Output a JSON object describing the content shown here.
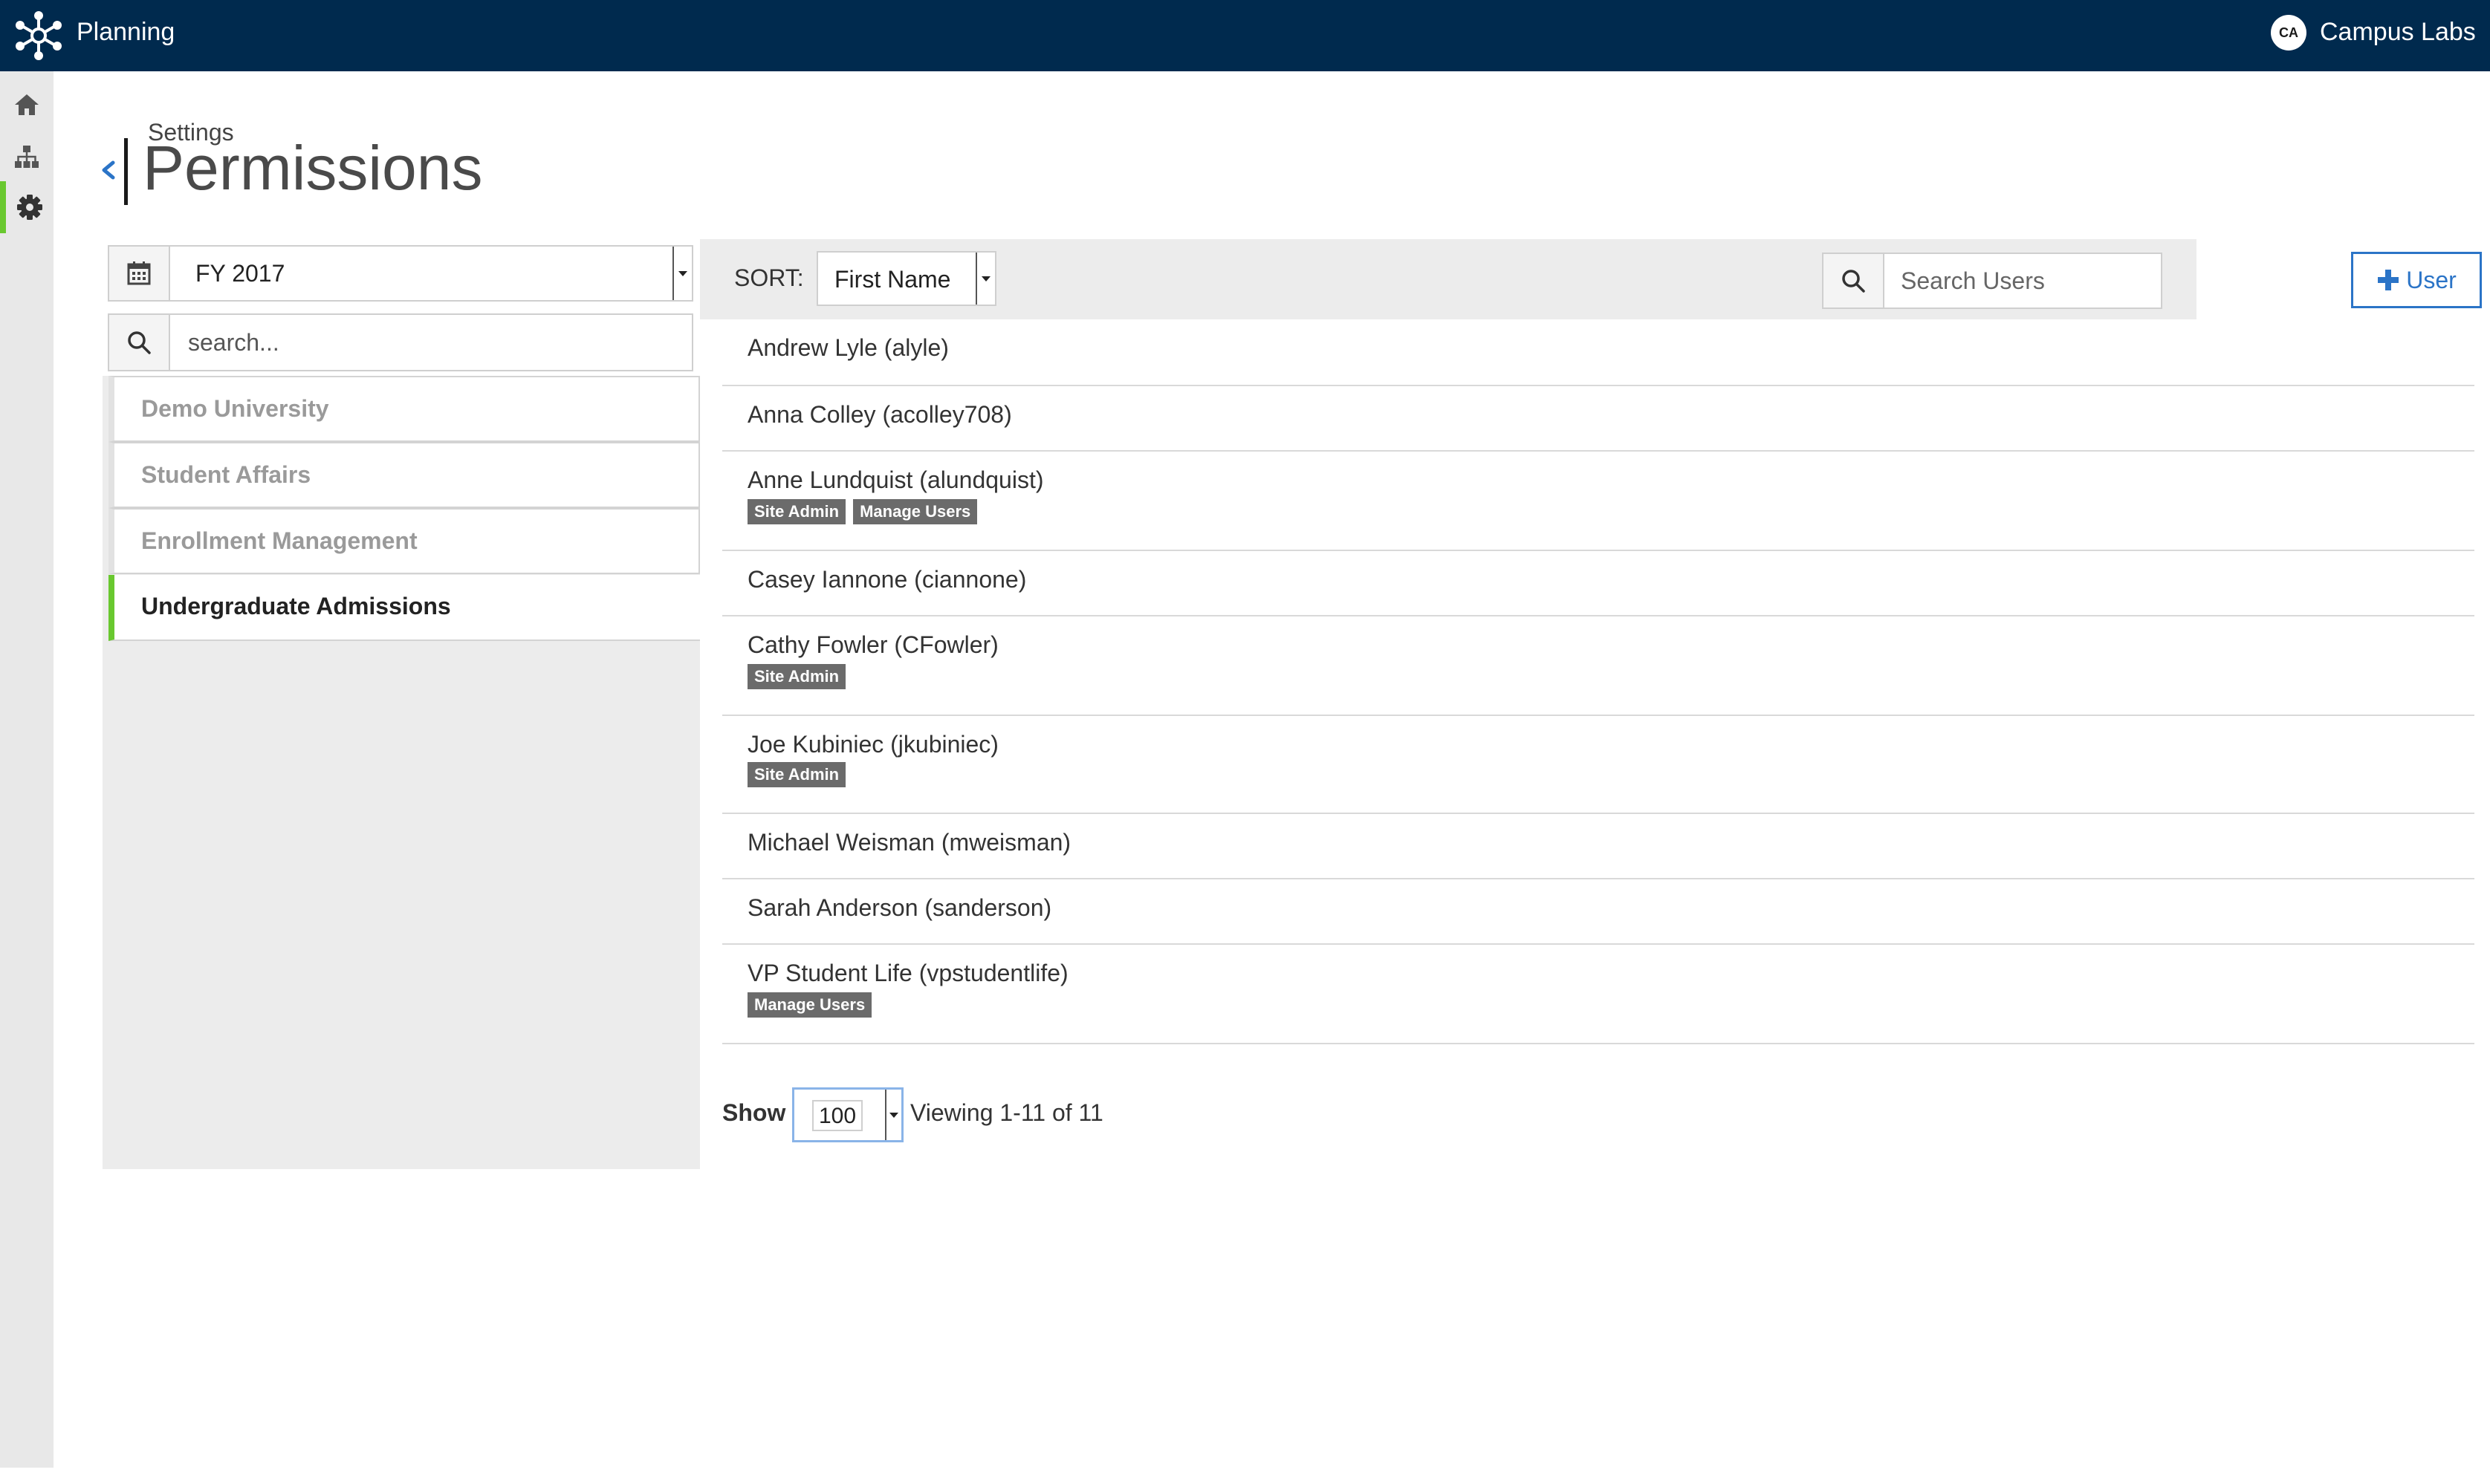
{
  "app": {
    "title": "Planning",
    "user_initials": "CA",
    "org_name": "Campus Labs"
  },
  "rail": {
    "items": [
      {
        "icon": "home-icon",
        "active": false
      },
      {
        "icon": "org-chart-icon",
        "active": false
      },
      {
        "icon": "gear-icon",
        "active": true
      }
    ],
    "accent": "#69c82f"
  },
  "header": {
    "breadcrumb": "Settings",
    "title": "Permissions"
  },
  "left_panel": {
    "fiscal_year": "FY 2017",
    "search_placeholder": "search...",
    "org_units": [
      {
        "label": "Demo University",
        "selected": false
      },
      {
        "label": "Student Affairs",
        "selected": false
      },
      {
        "label": "Enrollment Management",
        "selected": false
      },
      {
        "label": "Undergraduate Admissions",
        "selected": true
      }
    ]
  },
  "toolbar": {
    "sort_label": "SORT:",
    "sort_value": "First Name",
    "search_placeholder": "Search Users",
    "add_user_label": "User"
  },
  "users": [
    {
      "name": "Andrew Lyle (alyle)",
      "badges": []
    },
    {
      "name": "Anna Colley (acolley708)",
      "badges": []
    },
    {
      "name": "Anne Lundquist (alundquist)",
      "badges": [
        "Site Admin",
        "Manage Users"
      ]
    },
    {
      "name": "Casey Iannone (ciannone)",
      "badges": []
    },
    {
      "name": "Cathy Fowler (CFowler)",
      "badges": [
        "Site Admin"
      ]
    },
    {
      "name": "Joe Kubiniec (jkubiniec)",
      "badges": [
        "Site Admin"
      ]
    },
    {
      "name": "Michael Weisman (mweisman)",
      "badges": []
    },
    {
      "name": "Sarah Anderson (sanderson)",
      "badges": []
    },
    {
      "name": "VP Student Life (vpstudentlife)",
      "badges": [
        "Manage Users"
      ]
    }
  ],
  "pagination": {
    "show_label": "Show",
    "page_size": "100",
    "viewing": "Viewing 1-11 of 11"
  },
  "colors": {
    "topbar": "#002a4e",
    "accent_green": "#69c82f",
    "link_blue": "#2b74c7",
    "badge": "#6b6b6b"
  }
}
